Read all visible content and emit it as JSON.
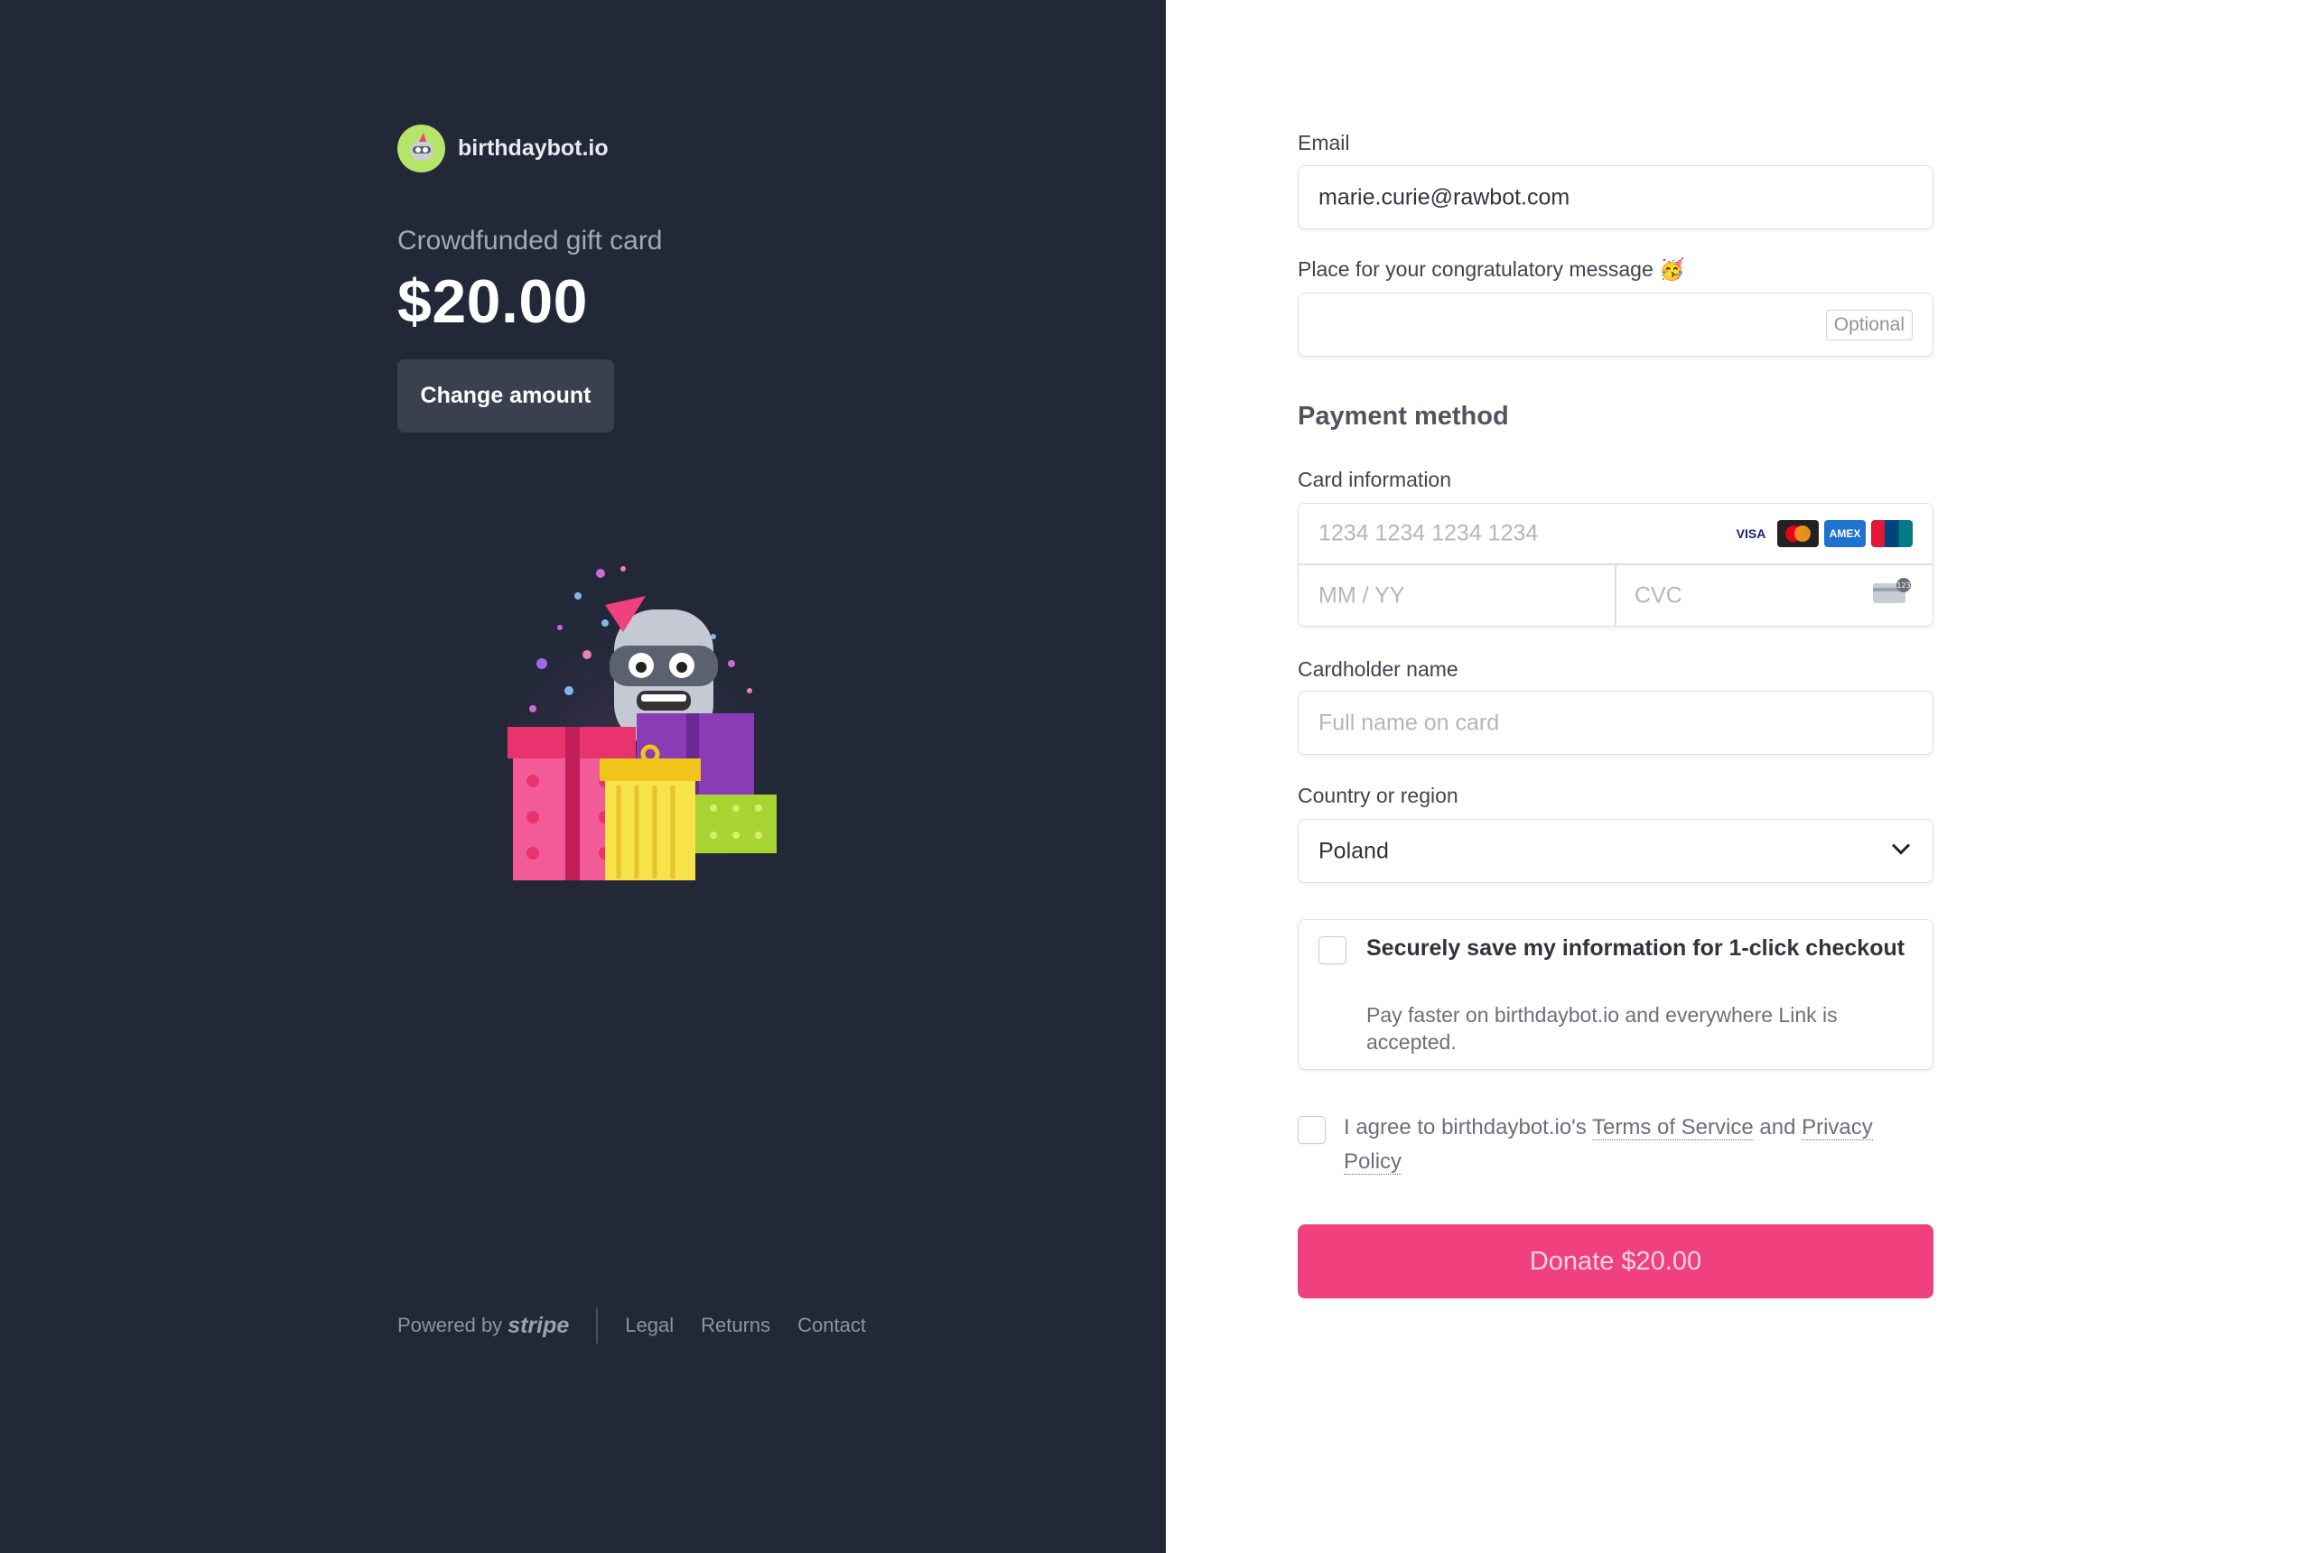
{
  "brand": {
    "name": "birthdaybot.io",
    "logo_icon": "robot-logo-icon"
  },
  "product": {
    "name": "Crowdfunded gift card",
    "price": "$20.00",
    "change_amount_label": "Change amount"
  },
  "illustration": {
    "icon": "robot-with-gifts-illustration"
  },
  "footer": {
    "powered_by": "Powered by",
    "stripe": "stripe",
    "links": [
      "Legal",
      "Returns",
      "Contact"
    ]
  },
  "form": {
    "email": {
      "label": "Email",
      "value": "marie.curie@rawbot.com"
    },
    "message": {
      "label": "Place for your congratulatory message 🥳",
      "optional": "Optional",
      "value": ""
    },
    "payment_method_title": "Payment method",
    "card": {
      "label": "Card information",
      "number_placeholder": "1234 1234 1234 1234",
      "expiry_placeholder": "MM / YY",
      "cvc_placeholder": "CVC",
      "brands": [
        "VISA",
        "mastercard",
        "AMEX",
        "UnionPay"
      ]
    },
    "cardholder": {
      "label": "Cardholder name",
      "placeholder": "Full name on card"
    },
    "country": {
      "label": "Country or region",
      "value": "Poland"
    },
    "save": {
      "title": "Securely save my information for 1-click checkout",
      "description": "Pay faster on birthdaybot.io and everywhere Link is accepted."
    },
    "agree": {
      "prefix": "I agree to birthdaybot.io's ",
      "terms": "Terms of Service",
      "and": " and ",
      "privacy": "Privacy Policy"
    },
    "donate_label": "Donate $20.00"
  },
  "colors": {
    "left_bg": "#222838",
    "accent": "#f0407d",
    "button_dark": "#3a404e"
  }
}
